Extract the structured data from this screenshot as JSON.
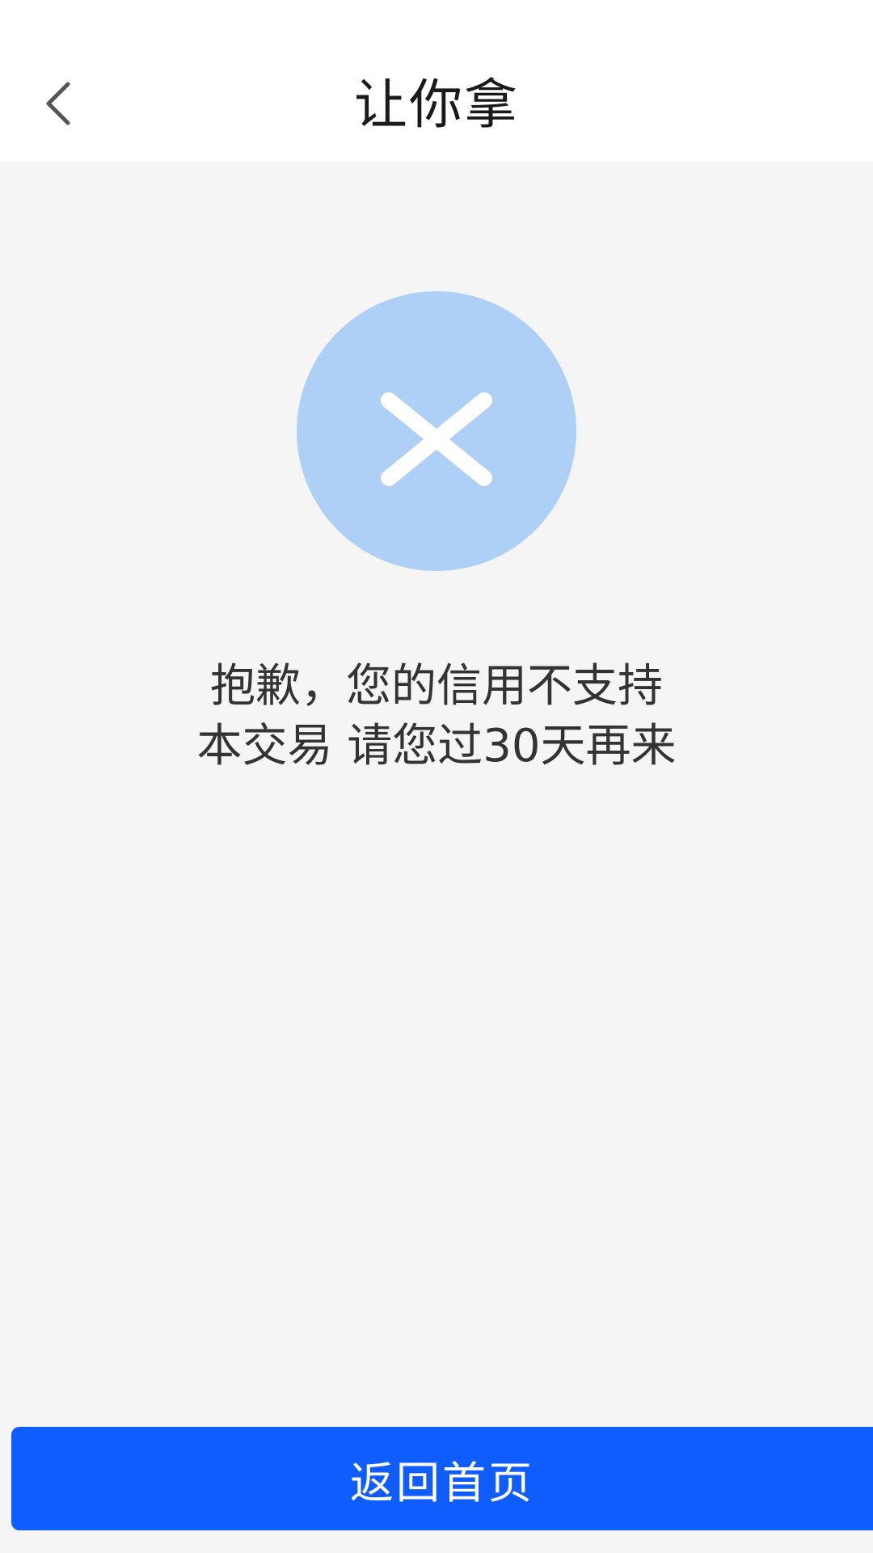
{
  "header": {
    "title": "让你拿",
    "back_icon": "chevron-left-icon"
  },
  "result": {
    "icon": "close-icon",
    "icon_bg_color": "#aed0f6",
    "message_line1": "抱歉，您的信用不支持",
    "message_line2": "本交易 请您过30天再来"
  },
  "footer": {
    "home_button_label": "返回首页",
    "button_color": "#0f5cff"
  }
}
